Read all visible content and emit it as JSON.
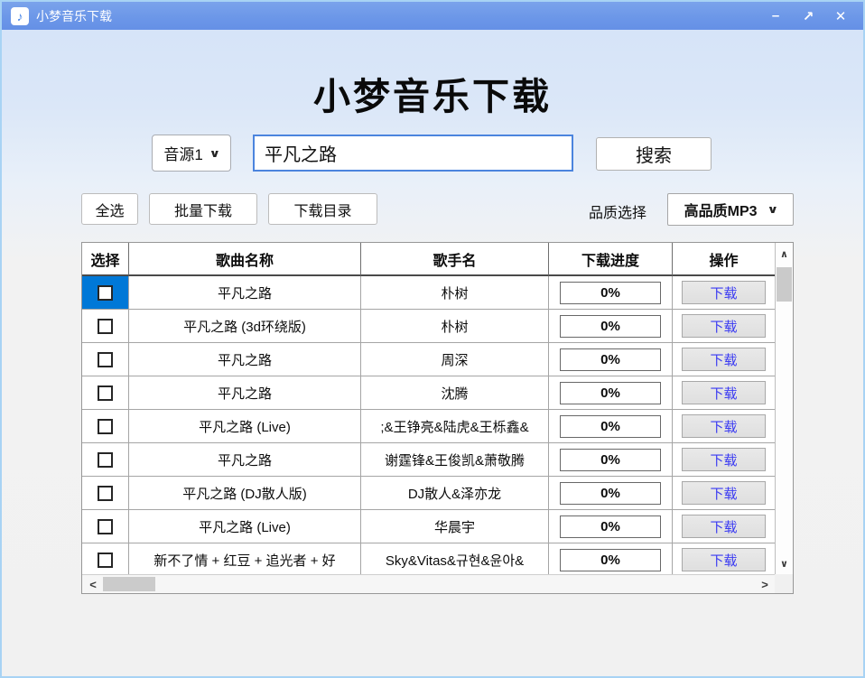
{
  "window": {
    "title": "小梦音乐下载"
  },
  "icons": {
    "app": "♪",
    "minimize": "–",
    "maximize": "↗",
    "close": "✕",
    "chevron_down": "∨",
    "scroll_up": "∧",
    "scroll_down": "∨",
    "scroll_left": "<",
    "scroll_right": ">"
  },
  "header": {
    "title": "小梦音乐下载"
  },
  "search": {
    "source_selected": "音源1",
    "query": "平凡之路",
    "search_button": "搜索"
  },
  "toolbar": {
    "select_all": "全选",
    "batch_download": "批量下载",
    "download_dir": "下载目录",
    "quality_label": "品质选择",
    "quality_selected": "高品质MP3"
  },
  "table": {
    "headers": [
      "选择",
      "歌曲名称",
      "歌手名",
      "下载进度",
      "操作"
    ],
    "download_label": "下载",
    "rows": [
      {
        "song": "平凡之路",
        "artist": "朴树",
        "progress": "0%",
        "selected_cell": true
      },
      {
        "song": "平凡之路 (3d环绕版)",
        "artist": "朴树",
        "progress": "0%",
        "selected_cell": false
      },
      {
        "song": "平凡之路",
        "artist": "周深",
        "progress": "0%",
        "selected_cell": false
      },
      {
        "song": "平凡之路",
        "artist": "沈腾",
        "progress": "0%",
        "selected_cell": false
      },
      {
        "song": "平凡之路 (Live)",
        "artist": ";&王铮亮&陆虎&王栎鑫&",
        "progress": "0%",
        "selected_cell": false
      },
      {
        "song": "平凡之路",
        "artist": "谢霆锋&王俊凯&萧敬腾",
        "progress": "0%",
        "selected_cell": false
      },
      {
        "song": "平凡之路 (DJ散人版)",
        "artist": "DJ散人&泽亦龙",
        "progress": "0%",
        "selected_cell": false
      },
      {
        "song": "平凡之路 (Live)",
        "artist": "华晨宇",
        "progress": "0%",
        "selected_cell": false
      },
      {
        "song": "新不了情 + 红豆 + 追光者 + 好",
        "artist": "Sky&Vitas&규현&윤아&",
        "progress": "0%",
        "selected_cell": false
      }
    ]
  },
  "colors": {
    "titlebar": "#6b96e8",
    "selection_blue": "#0078d7",
    "search_border": "#4b84de",
    "download_text": "#3a3af2",
    "content_top": "#d6e4f8",
    "content_bottom": "#f1f1f1"
  }
}
